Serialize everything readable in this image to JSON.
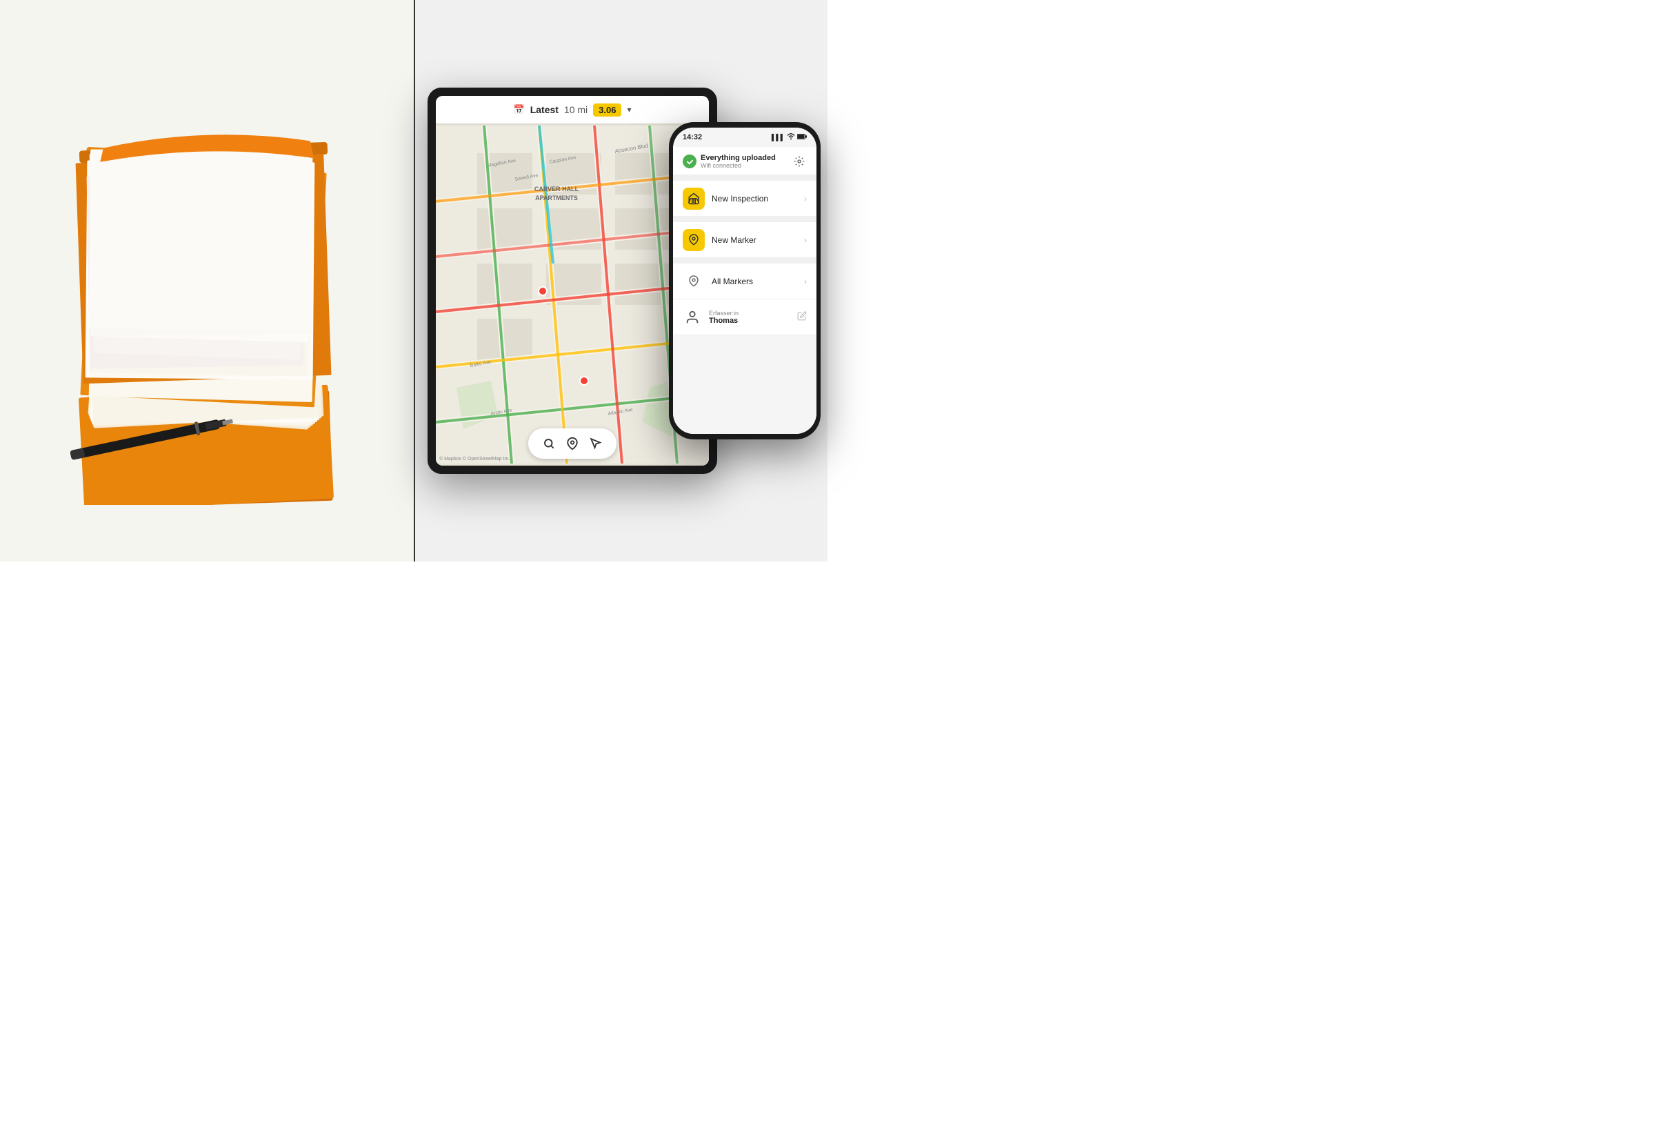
{
  "layout": {
    "divider_color": "#333333"
  },
  "tablet": {
    "map_header": {
      "label": "Latest",
      "distance": "10 mi",
      "badge": "3.06"
    },
    "map_attribution": "© Mapbox © OpenStreetMap Im..."
  },
  "phone": {
    "status_bar": {
      "time": "14:32",
      "icons": [
        "signal",
        "wifi",
        "battery"
      ]
    },
    "status_section": {
      "title": "Everything uploaded",
      "subtitle": "Wifi connected",
      "check_icon": "✓",
      "gear_icon": "⚙"
    },
    "menu_items": [
      {
        "label": "New Inspection",
        "icon": "🚧",
        "icon_type": "yellow",
        "chevron": "›"
      },
      {
        "label": "New Marker",
        "icon": "📍",
        "icon_type": "yellow",
        "chevron": "›"
      },
      {
        "label": "All Markers",
        "icon": "📍",
        "icon_type": "outline",
        "chevron": "›"
      }
    ],
    "user_section": {
      "label": "Erfasser:in",
      "name": "Thomas",
      "edit_icon": "✏"
    }
  }
}
